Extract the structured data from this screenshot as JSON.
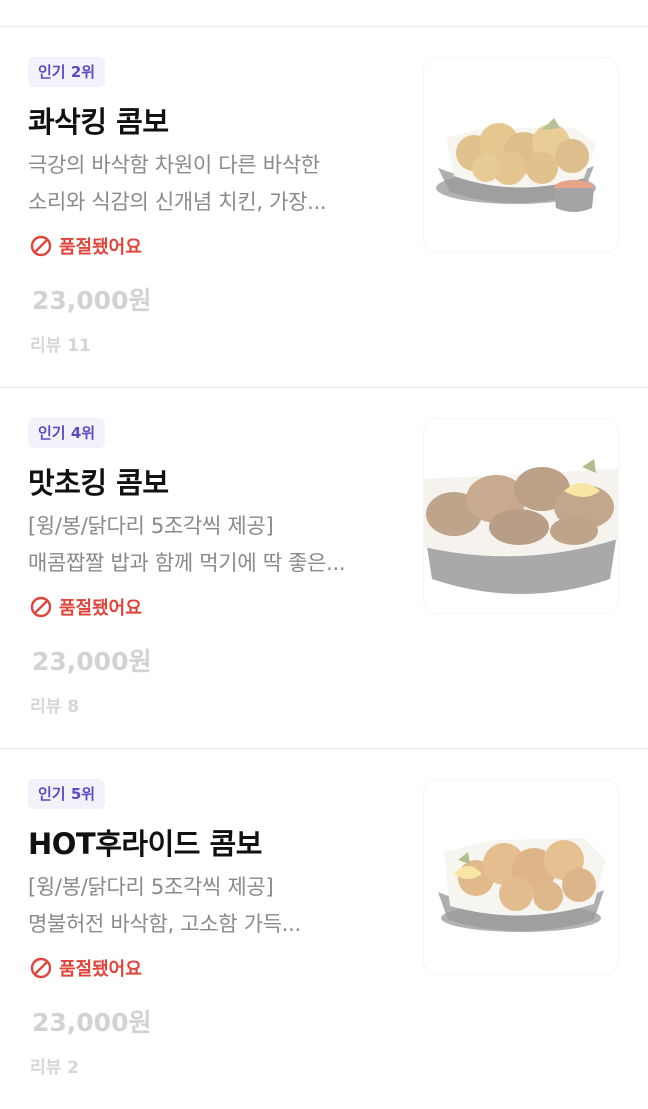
{
  "items": [
    {
      "rank": "인기 2위",
      "name": "콰삭킹 콤보",
      "desc_line1": "극강의 바삭함 차원이 다른 바삭한",
      "desc_line2": "소리와 식감의 신개념 치킨, 가장...",
      "status": "품절됐어요",
      "price": "23,000원",
      "review": "리뷰 11",
      "image_icon": "fried-chicken-basket-with-sauce"
    },
    {
      "rank": "인기 4위",
      "name": "맛초킹 콤보",
      "desc_line1": "[윙/봉/닭다리 5조각씩 제공]",
      "desc_line2": "매콤짭짤 밥과 함께 먹기에 딱 좋은...",
      "status": "품절됐어요",
      "price": "23,000원",
      "review": "리뷰 8",
      "image_icon": "glazed-chicken-basket-with-lemon"
    },
    {
      "rank": "인기 5위",
      "name": "HOT후라이드 콤보",
      "desc_line1": "[윙/봉/닭다리 5조각씩 제공]",
      "desc_line2": "명불허전 바삭함, 고소함 가득...",
      "status": "품절됐어요",
      "price": "23,000원",
      "review": "리뷰 2",
      "image_icon": "fried-chicken-basket-with-lemon"
    }
  ],
  "colors": {
    "badge_text": "#5b4cc4",
    "badge_bg": "#f3f2fb",
    "soldout": "#e0443a",
    "price_disabled": "#d2d2d2"
  }
}
